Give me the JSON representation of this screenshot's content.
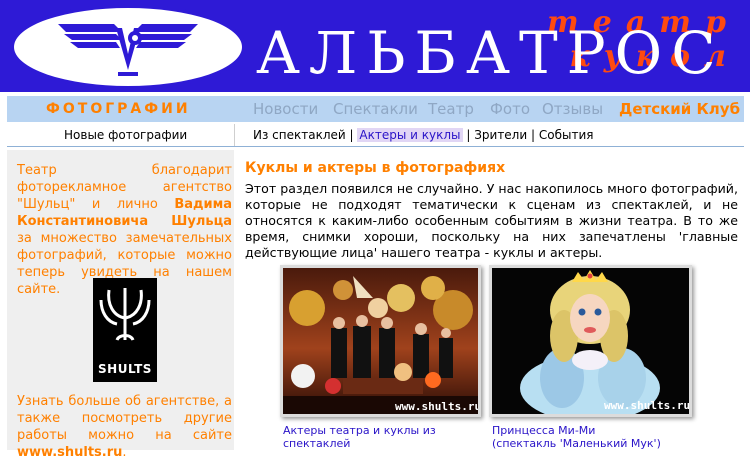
{
  "header": {
    "subtitle": "театр кукол",
    "title": "АЛЬБАТРОС"
  },
  "nav": {
    "section": "ФОТОГРАФИИ",
    "links": [
      "Новости",
      "Спектакли",
      "Театр",
      "Фото",
      "Отзывы"
    ],
    "club": "Детский Клуб"
  },
  "subnav": {
    "left": "Новые фотографии",
    "items": [
      "Из спектаклей",
      "Актеры и куклы",
      "Зрители",
      "События"
    ],
    "separator": "|"
  },
  "left": {
    "intro_1": "Театр благодарит фоторекламное агентство \"Шульц\" и лично",
    "intro_name": "Вадима Константиновича Шульца",
    "intro_2": "за множество замечательных фотографий, которые можно теперь увидеть на нашем сайте.",
    "logo_label": "SHULTS",
    "more_text": "Узнать больше об агентстве, а также посмотреть другие работы можно на сайте",
    "more_link": "www.shults.ru",
    "more_end": "."
  },
  "main": {
    "title": "Куклы и актеры в фотографиях",
    "paragraph": "Этот раздел появился не случайно. У нас накопилось много фотографий, которые не подходят тематически к сценам из спектаклей, и не относятся к каким-либо особенным событиям в жизни театра. В то же время, снимки хороши, поскольку на них запечатлены 'главные действующие лица' нашего театра - куклы и актеры."
  },
  "photos": [
    {
      "watermark": "www.shults.ru",
      "caption": "Актеры театра и куклы из спектаклей"
    },
    {
      "watermark": "www.shults.ru",
      "caption": "Принцесса Ми-Ми",
      "caption_2": "(спектакль 'Маленький Мук')"
    }
  ],
  "colors": {
    "header_bg": "#2e1ad6",
    "accent_orange": "#ff8000",
    "nav_bg": "#b8d4f2",
    "link_blue": "#2a14c8"
  }
}
